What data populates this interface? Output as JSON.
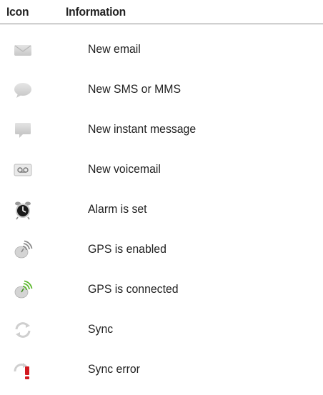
{
  "header": {
    "icon_label": "Icon",
    "info_label": "Information"
  },
  "rows": [
    {
      "icon": "envelope-icon",
      "label": "New email"
    },
    {
      "icon": "chat-bubble-icon",
      "label": "New SMS or MMS"
    },
    {
      "icon": "instant-message-icon",
      "label": "New instant message"
    },
    {
      "icon": "voicemail-icon",
      "label": "New voicemail"
    },
    {
      "icon": "alarm-clock-icon",
      "label": "Alarm is set"
    },
    {
      "icon": "gps-enabled-icon",
      "label": "GPS is enabled"
    },
    {
      "icon": "gps-connected-icon",
      "label": "GPS is connected"
    },
    {
      "icon": "sync-icon",
      "label": "Sync"
    },
    {
      "icon": "sync-error-icon",
      "label": "Sync error"
    }
  ],
  "colors": {
    "icon_gray": "#cfcfcf",
    "gps_green": "#5cb82e",
    "error_red": "#d2181f"
  }
}
